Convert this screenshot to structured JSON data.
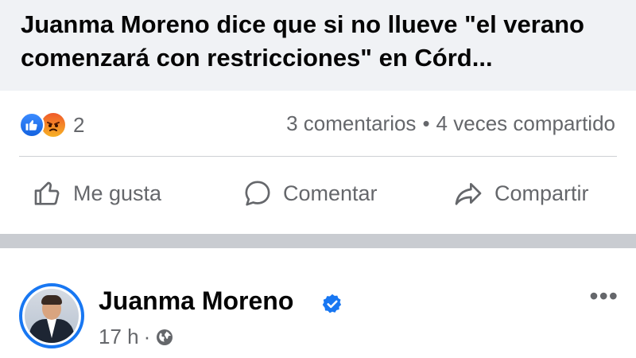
{
  "link_preview": {
    "title": "Juanma Moreno dice que si no llueve \"el verano comenzará con restricciones\" en Córd..."
  },
  "stats": {
    "reaction_count": "2",
    "comments": "3 comentarios",
    "separator": "•",
    "shares": "4 veces compartido",
    "reactions": [
      "like-reaction-icon",
      "angry-reaction-icon"
    ]
  },
  "actions": {
    "like_label": "Me gusta",
    "comment_label": "Comentar",
    "share_label": "Compartir"
  },
  "post": {
    "author": "Juanma Moreno",
    "verified": true,
    "time": "17 h",
    "separator": "·",
    "audience_icon": "globe-icon",
    "more_label": "•••"
  },
  "colors": {
    "accent": "#1877f2",
    "secondary_text": "#65676b",
    "preview_bg": "#f0f2f5"
  }
}
